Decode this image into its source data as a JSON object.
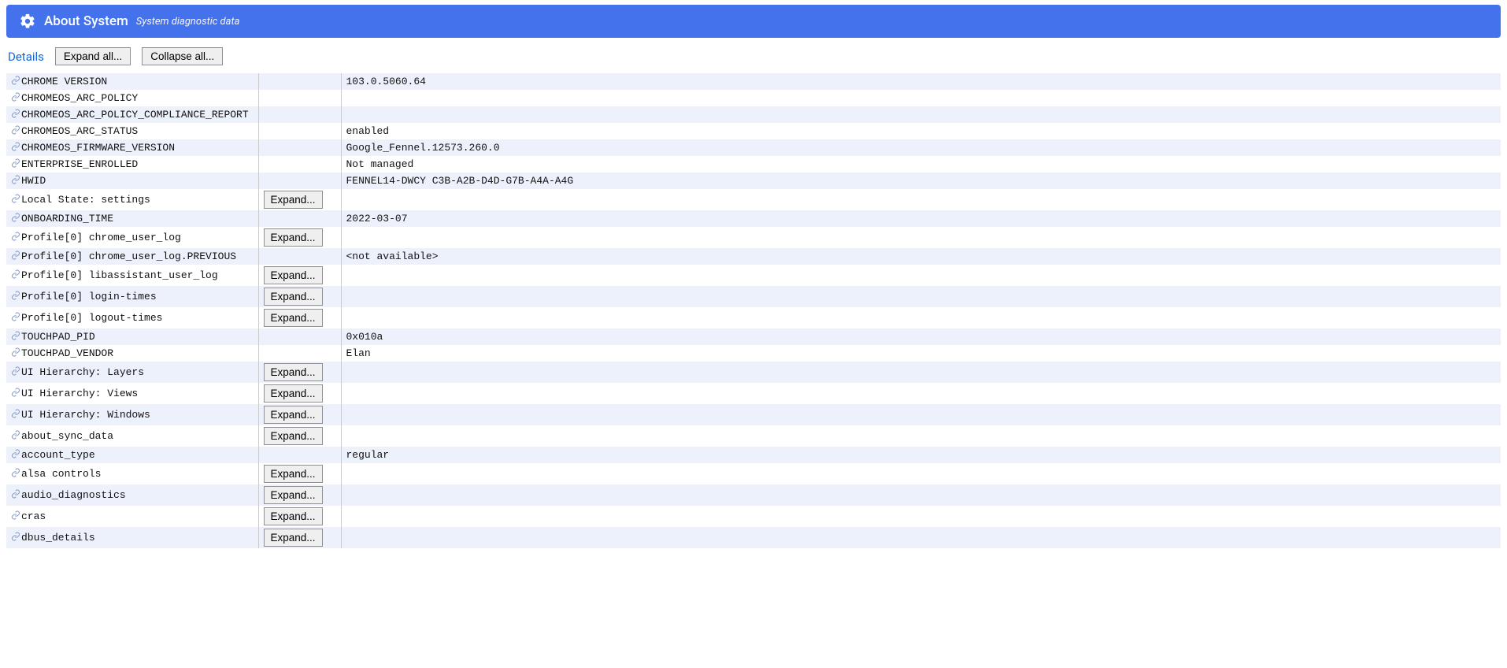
{
  "header": {
    "title": "About System",
    "subtitle": "System diagnostic data"
  },
  "toolbar": {
    "details": "Details",
    "expand_all": "Expand all...",
    "collapse_all": "Collapse all..."
  },
  "expand_label": "Expand...",
  "rows": [
    {
      "name": "CHROME VERSION",
      "value": "103.0.5060.64",
      "expandable": false
    },
    {
      "name": "CHROMEOS_ARC_POLICY",
      "value": "",
      "expandable": false
    },
    {
      "name": "CHROMEOS_ARC_POLICY_COMPLIANCE_REPORT",
      "value": "",
      "expandable": false
    },
    {
      "name": "CHROMEOS_ARC_STATUS",
      "value": "enabled",
      "expandable": false
    },
    {
      "name": "CHROMEOS_FIRMWARE_VERSION",
      "value": "Google_Fennel.12573.260.0",
      "expandable": false
    },
    {
      "name": "ENTERPRISE_ENROLLED",
      "value": "Not managed",
      "expandable": false
    },
    {
      "name": "HWID",
      "value": "FENNEL14-DWCY C3B-A2B-D4D-G7B-A4A-A4G",
      "expandable": false
    },
    {
      "name": "Local State: settings",
      "value": "",
      "expandable": true
    },
    {
      "name": "ONBOARDING_TIME",
      "value": "2022-03-07",
      "expandable": false
    },
    {
      "name": "Profile[0] chrome_user_log",
      "value": "",
      "expandable": true
    },
    {
      "name": "Profile[0] chrome_user_log.PREVIOUS",
      "value": "<not available>",
      "expandable": false
    },
    {
      "name": "Profile[0] libassistant_user_log",
      "value": "",
      "expandable": true
    },
    {
      "name": "Profile[0] login-times",
      "value": "",
      "expandable": true
    },
    {
      "name": "Profile[0] logout-times",
      "value": "",
      "expandable": true
    },
    {
      "name": "TOUCHPAD_PID",
      "value": "0x010a",
      "expandable": false
    },
    {
      "name": "TOUCHPAD_VENDOR",
      "value": "Elan",
      "expandable": false
    },
    {
      "name": "UI Hierarchy: Layers",
      "value": "",
      "expandable": true
    },
    {
      "name": "UI Hierarchy: Views",
      "value": "",
      "expandable": true
    },
    {
      "name": "UI Hierarchy: Windows",
      "value": "",
      "expandable": true
    },
    {
      "name": "about_sync_data",
      "value": "",
      "expandable": true
    },
    {
      "name": "account_type",
      "value": "regular",
      "expandable": false
    },
    {
      "name": "alsa controls",
      "value": "",
      "expandable": true
    },
    {
      "name": "audio_diagnostics",
      "value": "",
      "expandable": true
    },
    {
      "name": "cras",
      "value": "",
      "expandable": true
    },
    {
      "name": "dbus_details",
      "value": "",
      "expandable": true
    }
  ]
}
